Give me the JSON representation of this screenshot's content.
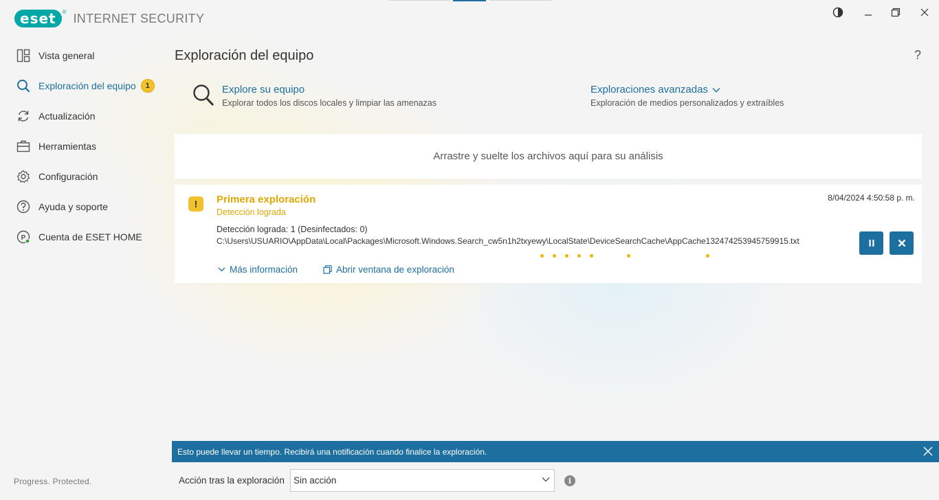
{
  "app": {
    "logo_text": "eset",
    "logo_tm": "®",
    "title": "INTERNET SECURITY"
  },
  "window_controls": [
    "contrast-icon",
    "minimize-icon",
    "restore-icon",
    "close-icon"
  ],
  "sidebar": {
    "items": [
      {
        "label": "Vista general",
        "icon": "dashboard-icon"
      },
      {
        "label": "Exploración del equipo",
        "icon": "search-icon",
        "active": true,
        "badge": "1"
      },
      {
        "label": "Actualización",
        "icon": "refresh-icon"
      },
      {
        "label": "Herramientas",
        "icon": "toolbox-icon"
      },
      {
        "label": "Configuración",
        "icon": "gear-icon"
      },
      {
        "label": "Ayuda y soporte",
        "icon": "help-icon"
      },
      {
        "label": "Cuenta de ESET HOME",
        "icon": "eset-home-icon",
        "icon_letter": "P"
      }
    ],
    "footer": "Progress. Protected."
  },
  "main": {
    "title": "Exploración del equipo",
    "help": "?",
    "scan_computer": {
      "title": "Explore su equipo",
      "subtitle": "Explorar todos los discos locales y limpiar las amenazas"
    },
    "advanced_scans": {
      "title": "Exploraciones avanzadas",
      "subtitle": "Exploración de medios personalizados y extraíbles"
    },
    "dropzone": "Arrastre y suelte los archivos aquí para su análisis",
    "scan_card": {
      "warn_symbol": "!",
      "title": "Primera exploración",
      "status": "Detección lograda",
      "date": "8/04/2024 4:50:58 p. m.",
      "detections": "Detección lograda: 1 (Desinfectados: 0)",
      "current_file": "C:\\Users\\USUARIO\\AppData\\Local\\Packages\\Microsoft.Windows.Search_cw5n1h2txyewy\\LocalState\\DeviceSearchCache\\AppCache132474253945759915.txt",
      "more_info": "Más información",
      "open_window": "Abrir ventana de exploración"
    }
  },
  "notice": {
    "text": "Esto puede llevar un tiempo. Recibirá una notificación cuando finalice la exploración."
  },
  "after_scan": {
    "label": "Acción tras la exploración",
    "selected": "Sin acción",
    "info": "i"
  },
  "colors": {
    "accent": "#1d6fa0",
    "warning": "#f2c12e",
    "brand": "#00a7a7"
  }
}
